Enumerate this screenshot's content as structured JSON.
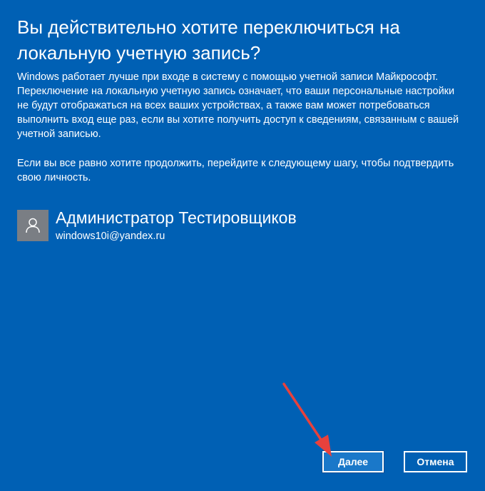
{
  "dialog": {
    "title": "Вы действительно хотите переключиться на локальную учетную запись?",
    "paragraph1": "Windows работает лучше при входе в систему с помощью учетной записи Майкрософт. Переключение на локальную учетную запись означает, что ваши персональные настройки не будут отображаться на всех ваших устройствах, а также вам может потребоваться выполнить вход еще раз, если вы хотите получить доступ к сведениям, связанным с вашей учетной записью.",
    "paragraph2": "Если вы все равно хотите продолжить, перейдите к следующему шагу, чтобы подтвердить свою личность."
  },
  "account": {
    "name": "Администратор Тестировщиков",
    "email": "windows10i@yandex.ru",
    "avatar_icon": "person-icon"
  },
  "buttons": {
    "next_label": "Далее",
    "cancel_label": "Отмена"
  },
  "annotation": {
    "arrow_icon": "red-arrow-icon",
    "arrow_color": "#e8413c"
  },
  "colors": {
    "background": "#0060b4",
    "text": "#ffffff",
    "avatar_bg": "#7a7e84"
  }
}
